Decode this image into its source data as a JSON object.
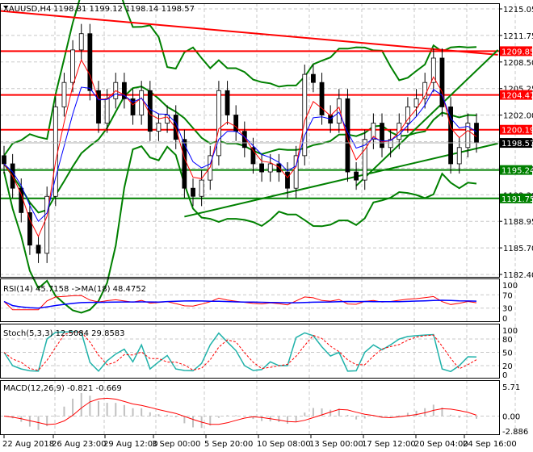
{
  "header": {
    "symbol": "XAUUSD,H4",
    "ohlc": "1198.81 1199.12 1198.14 1198.57"
  },
  "colors": {
    "resistance": "#ff0000",
    "support": "#008000",
    "price_label_bg": "#000000",
    "ma_fast": "#ff0000",
    "ma_slow": "#0000ff",
    "bollinger": "#008000",
    "stoch_main": "#20b2aa",
    "stoch_signal": "#ff0000",
    "macd_hist": "#c0c0c0",
    "macd_signal": "#ff0000"
  },
  "chart_data": {
    "type": "candlestick",
    "title": "XAUUSD,H4",
    "ylim": [
      1182.4,
      1215.05
    ],
    "y_ticks": [
      "1215.05",
      "1211.75",
      "1208.50",
      "1205.25",
      "1202.00",
      "1198.75",
      "1195.50",
      "1192.30",
      "1188.95",
      "1185.70",
      "1182.40"
    ],
    "x_ticks": [
      "22 Aug 2018",
      "26 Aug 23:00",
      "29 Aug 12:00",
      "3 Sep 00:00",
      "5 Sep 20:00",
      "10 Sep 08:00",
      "13 Sep 00:00",
      "17 Sep 12:00",
      "20 Sep 04:00",
      "24 Sep 16:00"
    ],
    "closes": [
      1196,
      1193,
      1190,
      1186,
      1185,
      1192,
      1203,
      1206,
      1210,
      1212,
      1205,
      1201,
      1204,
      1206,
      1204,
      1202,
      1205,
      1200,
      1201,
      1202,
      1199,
      1193,
      1192,
      1194,
      1197,
      1205,
      1202,
      1200,
      1198,
      1196,
      1195,
      1196,
      1195,
      1193,
      1197,
      1207,
      1206,
      1202,
      1201,
      1204,
      1195,
      1194,
      1199,
      1201,
      1198,
      1199,
      1201,
      1203,
      1204,
      1206,
      1209,
      1203,
      1196,
      1198,
      1201,
      1198.57
    ],
    "current_price": "1198.57",
    "levels": [
      {
        "price": 1209.85,
        "label": "1209.85",
        "kind": "resistance"
      },
      {
        "price": 1204.47,
        "label": "1204.47",
        "kind": "resistance"
      },
      {
        "price": 1200.19,
        "label": "1200.19",
        "kind": "resistance"
      },
      {
        "price": 1195.24,
        "label": "1195.24",
        "kind": "support"
      },
      {
        "price": 1191.75,
        "label": "1191.75",
        "kind": "support"
      }
    ],
    "trendlines": [
      {
        "from": [
          -0.5,
          1214.8
        ],
        "to": [
          57.5,
          1209.4
        ],
        "kind": "resistance"
      },
      {
        "from": [
          21,
          1189.5
        ],
        "to": [
          57.5,
          1198.5
        ],
        "kind": "support"
      },
      {
        "from": [
          41,
          1193.3
        ],
        "to": [
          57.5,
          1210.0
        ],
        "kind": "support"
      }
    ],
    "indicators": {
      "rsi": {
        "label": "RSI(14) 45.7158  ->MA(18) 48.4752",
        "ticks": [
          "100",
          "70",
          "30",
          "0"
        ],
        "ylim": [
          0,
          100
        ]
      },
      "stoch": {
        "label": "Stoch(5,3,3) 12.5084 29.8583",
        "ticks": [
          "100",
          "80",
          "50",
          "20",
          "0"
        ],
        "ylim": [
          0,
          100
        ]
      },
      "macd": {
        "label": "MACD(12,26,9) -0.821 -0.669",
        "ticks": [
          "5.71",
          "0.00",
          "-2.886"
        ],
        "ylim": [
          -2.886,
          5.71
        ]
      }
    }
  }
}
